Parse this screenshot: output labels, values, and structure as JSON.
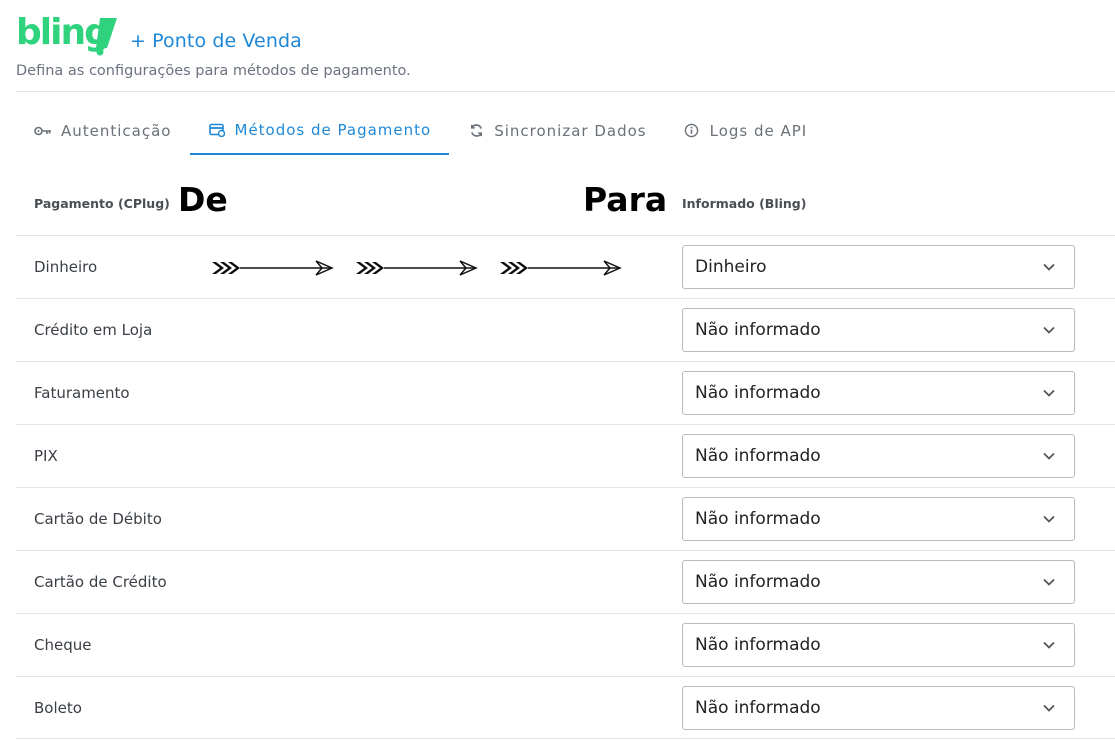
{
  "header": {
    "logo_text": "bling!",
    "app_title": "+ Ponto de Venda",
    "subtitle": "Defina as configurações para métodos de pagamento."
  },
  "tabs": [
    {
      "label": "Autenticação",
      "icon": "key-icon",
      "active": false
    },
    {
      "label": "Métodos de Pagamento",
      "icon": "card-icon",
      "active": true
    },
    {
      "label": "Sincronizar Dados",
      "icon": "sync-icon",
      "active": false
    },
    {
      "label": "Logs de API",
      "icon": "info-icon",
      "active": false
    }
  ],
  "table": {
    "col_left": "Pagamento (CPlug)",
    "col_right": "Informado (Bling)",
    "rows": [
      {
        "label": "Dinheiro",
        "value": "Dinheiro"
      },
      {
        "label": "Crédito em Loja",
        "value": "Não informado"
      },
      {
        "label": "Faturamento",
        "value": "Não informado"
      },
      {
        "label": "PIX",
        "value": "Não informado"
      },
      {
        "label": "Cartão de Débito",
        "value": "Não informado"
      },
      {
        "label": "Cartão de Crédito",
        "value": "Não informado"
      },
      {
        "label": "Cheque",
        "value": "Não informado"
      },
      {
        "label": "Boleto",
        "value": "Não informado"
      }
    ]
  },
  "annotation": {
    "from_label": "De",
    "to_label": "Para"
  },
  "colors": {
    "brand_green": "#2fd37e",
    "accent_blue": "#1f88d6"
  }
}
